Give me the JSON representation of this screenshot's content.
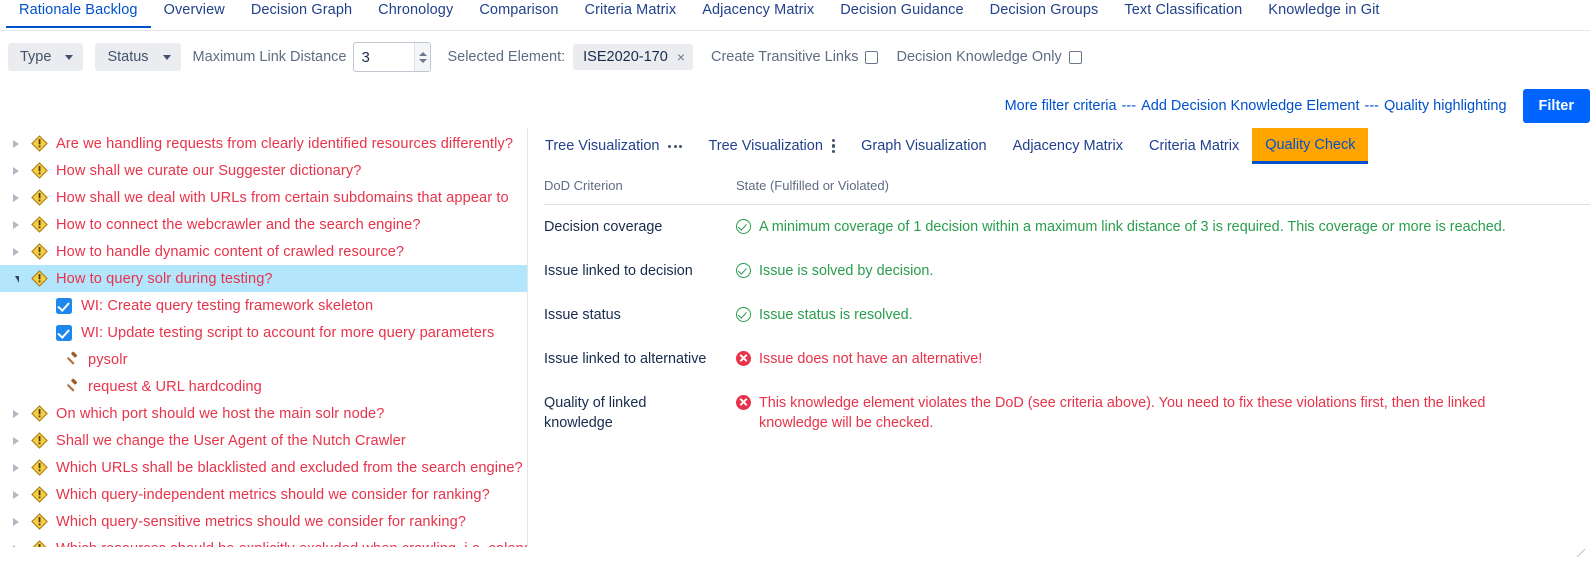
{
  "topnav": {
    "items": [
      {
        "label": "Rationale Backlog",
        "active": true
      },
      {
        "label": "Overview",
        "active": false
      },
      {
        "label": "Decision Graph",
        "active": false
      },
      {
        "label": "Chronology",
        "active": false
      },
      {
        "label": "Comparison",
        "active": false
      },
      {
        "label": "Criteria Matrix",
        "active": false
      },
      {
        "label": "Adjacency Matrix",
        "active": false
      },
      {
        "label": "Decision Guidance",
        "active": false
      },
      {
        "label": "Decision Groups",
        "active": false
      },
      {
        "label": "Text Classification",
        "active": false
      },
      {
        "label": "Knowledge in Git",
        "active": false
      }
    ]
  },
  "toolbar": {
    "type_label": "Type",
    "status_label": "Status",
    "max_link_distance_label": "Maximum Link Distance",
    "max_link_distance_value": "3",
    "selected_element_label": "Selected Element:",
    "selected_element_value": "ISE2020-170",
    "selected_element_remove": "×",
    "create_transitive_links_label": "Create Transitive Links",
    "decision_knowledge_only_label": "Decision Knowledge Only"
  },
  "links": {
    "more_filter_criteria": "More filter criteria",
    "sep1": "---",
    "add_decision_knowledge_element": "Add Decision Knowledge Element",
    "sep2": "---",
    "quality_highlighting": "Quality highlighting",
    "filter_button": "Filter"
  },
  "tree": {
    "rows": [
      {
        "label": "Are we handling requests from clearly identified resources differently?",
        "icon": "issue-icon",
        "twisty": "closed",
        "level": 0,
        "selected": false
      },
      {
        "label": "How shall we curate our Suggester dictionary?",
        "icon": "issue-icon",
        "twisty": "closed",
        "level": 0,
        "selected": false
      },
      {
        "label": "How shall we deal with URLs from certain subdomains that appear to",
        "icon": "issue-icon",
        "twisty": "closed",
        "level": 0,
        "selected": false
      },
      {
        "label": "How to connect the webcrawler and the search engine?",
        "icon": "issue-icon",
        "twisty": "closed",
        "level": 0,
        "selected": false
      },
      {
        "label": "How to handle dynamic content of crawled resource?",
        "icon": "issue-icon",
        "twisty": "closed",
        "level": 0,
        "selected": false
      },
      {
        "label": "How to query solr during testing?",
        "icon": "issue-icon",
        "twisty": "open",
        "level": 0,
        "selected": true
      },
      {
        "label": "WI: Create query testing framework skeleton",
        "icon": "checkbox-checked-icon",
        "twisty": "none",
        "level": 1,
        "selected": false
      },
      {
        "label": "WI: Update testing script to account for more query parameters",
        "icon": "checkbox-checked-icon",
        "twisty": "none",
        "level": 1,
        "selected": false
      },
      {
        "label": "pysolr",
        "icon": "gavel-icon",
        "twisty": "none",
        "level": 1,
        "selected": false
      },
      {
        "label": "request & URL hardcoding",
        "icon": "gavel-icon",
        "twisty": "none",
        "level": 1,
        "selected": false
      },
      {
        "label": "On which port should we host the main solr node?",
        "icon": "issue-icon",
        "twisty": "closed",
        "level": 0,
        "selected": false
      },
      {
        "label": "Shall we change the User Agent of the Nutch Crawler",
        "icon": "issue-icon",
        "twisty": "closed",
        "level": 0,
        "selected": false
      },
      {
        "label": "Which URLs shall be blacklisted and excluded from the search engine?",
        "icon": "issue-icon",
        "twisty": "closed",
        "level": 0,
        "selected": false
      },
      {
        "label": "Which query-independent metrics should we consider for ranking?",
        "icon": "issue-icon",
        "twisty": "closed",
        "level": 0,
        "selected": false
      },
      {
        "label": "Which query-sensitive metrics should we consider for ranking?",
        "icon": "issue-icon",
        "twisty": "closed",
        "level": 0,
        "selected": false
      },
      {
        "label": "Which resources should be explicitly excluded when crawling, i.e. calendars?",
        "icon": "issue-icon",
        "twisty": "closed",
        "level": 0,
        "selected": false
      }
    ]
  },
  "subtabs": {
    "items": [
      {
        "label": "Tree Visualization",
        "icon": "dots-horizontal-icon",
        "icon_side": "right",
        "highlight": false
      },
      {
        "label": "Tree Visualization",
        "icon": "dots-vertical-icon",
        "icon_side": "right",
        "highlight": false
      },
      {
        "label": "Graph Visualization",
        "icon": "",
        "icon_side": "",
        "highlight": false
      },
      {
        "label": "Adjacency Matrix",
        "icon": "",
        "icon_side": "",
        "highlight": false
      },
      {
        "label": "Criteria Matrix",
        "icon": "",
        "icon_side": "",
        "highlight": false
      },
      {
        "label": "Quality Check",
        "icon": "",
        "icon_side": "",
        "highlight": true
      }
    ]
  },
  "quality_check": {
    "header": {
      "criterion": "DoD Criterion",
      "state": "State (Fulfilled or Violated)"
    },
    "rows": [
      {
        "criterion": "Decision coverage",
        "state": "A minimum coverage of 1 decision within a maximum link distance of 3 is required. This coverage or more is reached.",
        "status": "ok"
      },
      {
        "criterion": "Issue linked to decision",
        "state": "Issue is solved by decision.",
        "status": "ok"
      },
      {
        "criterion": "Issue status",
        "state": "Issue status is resolved.",
        "status": "ok"
      },
      {
        "criterion": "Issue linked to alternative",
        "state": "Issue does not have an alternative!",
        "status": "bad"
      },
      {
        "criterion": "Quality of linked knowledge",
        "state": "This knowledge element violates the DoD (see criteria above). You need to fix these violations first, then the linked knowledge will be checked.",
        "status": "bad"
      }
    ]
  },
  "colors": {
    "accent_blue": "#0052cc",
    "link_blue": "#0065ff",
    "highlight_orange": "#ffa400",
    "issue_red": "#e8334a",
    "ok_green": "#2a9d4e",
    "selection_blue": "#b3e5fc"
  }
}
